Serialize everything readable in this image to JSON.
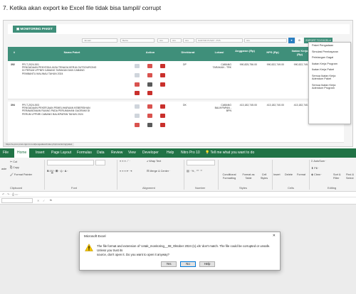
{
  "heading": "7. Ketika akan export ke Excel file tidak bisa tampil/ corrupt",
  "web": {
    "monitor_button": "MONITORING PAKET",
    "filters": {
      "f1": "Januari",
      "f2": "Berita",
      "f3": "ALL",
      "f4": "ALL",
      "f5": "ALL",
      "f6": "KANTOR PUSAT - PVS",
      "f7": "ALL"
    },
    "export_button": "EXPORT TO EXCEL",
    "table_headers": {
      "no": "#",
      "nama": "Nama Paket",
      "action": "Action",
      "direktorat": "Direktorat",
      "lokasi": "Lokasi",
      "anggaran": "Anggaran (Rp)",
      "hps": "HPS (Rp)",
      "ikatan": "Ikatan Kerja (Rp)"
    },
    "rows": [
      {
        "no": "392",
        "code": "PR-T-2024-501",
        "nama_line1": "PENGADAAN PENYEDIA JASA TENAGA KERJA OUTSOURCING",
        "nama_line2": "DI PERUM LPPNRI CABANG TARAKAN DAN CABANG",
        "nama_line3": "PEMBANTU MALINAU TAHUN 2024",
        "direktorat": "DP",
        "lokasi_line1": "CABANG",
        "lokasi_line2": "TARAKAN - TRK",
        "anggaran": "990,825,756.00",
        "hps": "990,522,749.00",
        "ikatan": "990,522,749.00",
        "status_line1": "Eval",
        "status_line2": "Pekal",
        "status_line3": "dek"
      },
      {
        "no": "394",
        "code": "PR-T-2024-503",
        "nama_line1": "PENGADAAN PEKERJAAN PEMELIHARAAN KEBERSIHAN",
        "nama_line2": "PERAWATANAN RUANG PADA PERUMAHAN GAGRAMI DI",
        "nama_line3": "PERUM LPPNRI CABANG BALIKPAPAN TAHUN 2024",
        "direktorat": "DK",
        "lokasi_line1": "CABANG",
        "lokasi_line2": "BALIKPAPAN -",
        "lokasi_line3": "BPN",
        "anggaran": "413,182,745.00",
        "hps": "413,182,740.00",
        "ikatan": "413,182,740.00",
        "status_line1": "Ikatan Kerja",
        "status_line2": "Ikatan Kerja Tanding",
        "status_line3": "alm 10/07/..."
      }
    ],
    "dropdown": [
      "Paket Pengadaan",
      "Simulasi Pembayaran",
      "Pelelangan Gagal",
      "Ikatan Kerja Program",
      "Ikatan Kerja Paket",
      "Semua Ikatan Kerja Adendum Paket",
      "Semua Ikatan Kerja Adendum Program"
    ],
    "status_url": "https://e-proc.prum-lppnri.co.id/pengadaan/index.php/monitoring/paket"
  },
  "excel": {
    "menu": [
      "File",
      "Home",
      "Insert",
      "Page Layout",
      "Formulas",
      "Data",
      "Review",
      "View",
      "Developer",
      "Help",
      "Nitro Pro 10",
      "Tell me what you want to do"
    ],
    "ribbon": {
      "cut": "Cut",
      "copy": "Copy",
      "format_painter": "Format Painter",
      "clipboard": "Clipboard",
      "font": "Font",
      "wrap_text": "Wrap Text",
      "merge_center": "Merge & Center",
      "alignment": "Alignment",
      "number": "Number",
      "conditional": "Conditional",
      "formatting": "Formatting",
      "format_as": "Format as",
      "table": "Table",
      "cell": "Cell",
      "styles_label": "Styles",
      "styles": "Styles",
      "insert": "Insert",
      "delete": "Delete",
      "format": "Format",
      "cells": "Cells",
      "autosum": "AutoSum",
      "fill": "Fill",
      "clear": "Clear",
      "sort": "Sort &",
      "filter": "Filter",
      "find": "Find &",
      "select": "Select",
      "editing": "Editing",
      "paste": "aste"
    },
    "formula_fx": "fx",
    "dialog": {
      "title": "Microsoft Excel",
      "line1": "The file format and extension of 'cetak_monitoring__08_Oktober 2024 (1).xls' don't match. The file could be corrupted or unsafe. Unless you trust its",
      "line2": "source, don't open it. Do you want to open it anyway?",
      "yes": "Yes",
      "no": "No",
      "help": "Help"
    }
  }
}
